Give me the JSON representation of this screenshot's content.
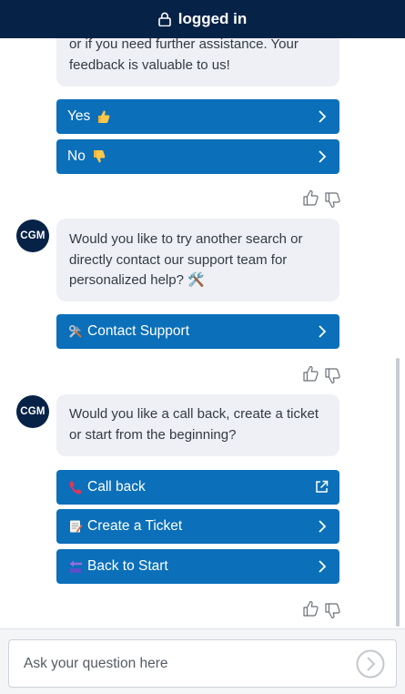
{
  "header": {
    "title": "logged in",
    "icon": "lock-icon"
  },
  "messages": [
    {
      "text": "or if you need further assistance. Your feedback is valuable to us!"
    },
    {
      "avatar": "CGM",
      "text": "Would you like to try another search or directly contact our support team for personalized help? 🛠️"
    },
    {
      "avatar": "CGM",
      "text": "Would you like a call back, create a ticket or start from the beginning?"
    }
  ],
  "buttons": {
    "yes": "Yes",
    "no": "No",
    "contact_support": "Contact Support",
    "call_back": "Call back",
    "create_ticket": "Create a Ticket",
    "back_to_start": "Back to Start"
  },
  "composer": {
    "placeholder": "Ask your question here"
  },
  "colors": {
    "header": "#072247",
    "button": "#0b6fb9",
    "bubble": "#eef0f5"
  }
}
